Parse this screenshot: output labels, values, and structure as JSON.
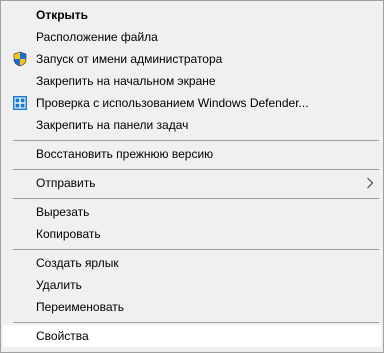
{
  "menu": {
    "items": [
      {
        "label": "Открыть"
      },
      {
        "label": "Расположение файла"
      },
      {
        "label": "Запуск от имени администратора",
        "icon": "uac-shield-icon"
      },
      {
        "label": "Закрепить на начальном экране"
      },
      {
        "label": "Проверка с использованием Windows Defender...",
        "icon": "windows-defender-icon"
      },
      {
        "label": "Закрепить на панели задач"
      },
      {
        "label": "Восстановить прежнюю версию"
      },
      {
        "label": "Отправить",
        "icon": "chevron-right-icon"
      },
      {
        "label": "Вырезать"
      },
      {
        "label": "Копировать"
      },
      {
        "label": "Создать ярлык"
      },
      {
        "label": "Удалить"
      },
      {
        "label": "Переименовать"
      },
      {
        "label": "Свойства"
      }
    ]
  },
  "colors": {
    "menu_background": "#f0f0f0",
    "menu_border": "#a0a0a0",
    "hover_background": "#ffffff",
    "shield_blue": "#1d6fd6",
    "shield_yellow": "#f5c518",
    "defender_blue": "#1979d6"
  }
}
